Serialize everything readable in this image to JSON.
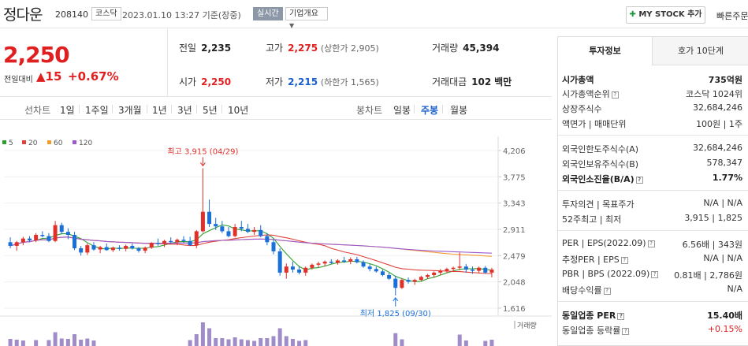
{
  "header": {
    "name": "정다운",
    "code": "208140",
    "market": "코스닥",
    "datetime": "2023.01.10 13:27  기준(장중)",
    "realtime": "실시간",
    "company_overview": "기업개요",
    "mystock_label": "MY STOCK 추가",
    "quick_order": "빠른주문"
  },
  "price": {
    "current": "2,250",
    "change_label": "전일대비",
    "change_value": "15",
    "change_pct": "+0.67%",
    "prev_close_label": "전일",
    "prev_close": "2,235",
    "high_label": "고가",
    "high": "2,275",
    "upper_limit": "(상한가 2,905)",
    "volume_label": "거래량",
    "volume": "45,394",
    "open_label": "시가",
    "open": "2,250",
    "low_label": "저가",
    "low": "2,215",
    "lower_limit": "(하한가 1,565)",
    "amount_label": "거래대금",
    "amount": "102",
    "amount_unit": "백만"
  },
  "chart_tabs": {
    "line_label": "선차트",
    "line_periods": [
      "1일",
      "1주일",
      "3개월",
      "1년",
      "3년",
      "5년",
      "10년"
    ],
    "candle_label": "봉차트",
    "candle_periods": [
      "일봉",
      "주봉",
      "월봉"
    ],
    "candle_active": "주봉"
  },
  "chart_data": {
    "type": "candlestick",
    "legend": [
      {
        "name": "5",
        "color": "#2ca02c"
      },
      {
        "name": "20",
        "color": "#e0403a"
      },
      {
        "name": "60",
        "color": "#f39c32"
      },
      {
        "name": "120",
        "color": "#9b59d0"
      }
    ],
    "y_ticks": [
      "4,206",
      "3,775",
      "3,343",
      "2,911",
      "2,479",
      "2,048",
      "1,616"
    ],
    "ylim": [
      1616,
      4206
    ],
    "annotations": {
      "high": "최고 3,915 (04/29)",
      "low": "최저 1,825 (09/30)"
    },
    "volume_label": "거래량",
    "candles": [
      [
        2700,
        2780,
        2600,
        2640
      ],
      [
        2640,
        2720,
        2560,
        2700
      ],
      [
        2700,
        2790,
        2650,
        2760
      ],
      [
        2760,
        2800,
        2700,
        2730
      ],
      [
        2730,
        2850,
        2700,
        2820
      ],
      [
        2820,
        2880,
        2780,
        2800
      ],
      [
        2800,
        2850,
        2700,
        2720
      ],
      [
        2720,
        3050,
        2700,
        2980
      ],
      [
        2980,
        3020,
        2830,
        2870
      ],
      [
        2870,
        2930,
        2750,
        2820
      ],
      [
        2820,
        2870,
        2570,
        2600
      ],
      [
        2600,
        2640,
        2480,
        2530
      ],
      [
        2530,
        2680,
        2490,
        2650
      ],
      [
        2650,
        2700,
        2560,
        2580
      ],
      [
        2580,
        2640,
        2520,
        2620
      ],
      [
        2620,
        2680,
        2560,
        2570
      ],
      [
        2570,
        2630,
        2540,
        2610
      ],
      [
        2610,
        2650,
        2560,
        2590
      ],
      [
        2590,
        2660,
        2550,
        2640
      ],
      [
        2640,
        2680,
        2580,
        2600
      ],
      [
        2600,
        2620,
        2530,
        2560
      ],
      [
        2560,
        2630,
        2520,
        2610
      ],
      [
        2610,
        2700,
        2590,
        2690
      ],
      [
        2690,
        2760,
        2640,
        2680
      ],
      [
        2680,
        2740,
        2620,
        2720
      ],
      [
        2720,
        2780,
        2680,
        2700
      ],
      [
        2700,
        2760,
        2650,
        2740
      ],
      [
        2740,
        2800,
        2690,
        2720
      ],
      [
        2720,
        2790,
        2640,
        2650
      ],
      [
        2650,
        2900,
        2600,
        2880
      ],
      [
        2880,
        3915,
        2860,
        3200
      ],
      [
        3200,
        3400,
        2950,
        3000
      ],
      [
        3000,
        3100,
        2900,
        2960
      ],
      [
        2960,
        3050,
        2850,
        2880
      ],
      [
        2880,
        2950,
        2780,
        2800
      ],
      [
        2800,
        3000,
        2780,
        2950
      ],
      [
        2950,
        3050,
        2880,
        2920
      ],
      [
        2920,
        3000,
        2850,
        2870
      ],
      [
        2870,
        2950,
        2820,
        2900
      ],
      [
        2900,
        2980,
        2780,
        2800
      ],
      [
        2800,
        2850,
        2650,
        2700
      ],
      [
        2700,
        2750,
        2500,
        2550
      ],
      [
        2550,
        2600,
        2150,
        2200
      ],
      [
        2200,
        2350,
        2100,
        2300
      ],
      [
        2300,
        2380,
        2200,
        2250
      ],
      [
        2250,
        2300,
        2170,
        2200
      ],
      [
        2200,
        2300,
        2150,
        2280
      ],
      [
        2280,
        2350,
        2250,
        2330
      ],
      [
        2330,
        2380,
        2290,
        2350
      ],
      [
        2350,
        2400,
        2300,
        2380
      ],
      [
        2380,
        2420,
        2340,
        2360
      ],
      [
        2360,
        2420,
        2330,
        2400
      ],
      [
        2400,
        2460,
        2360,
        2380
      ],
      [
        2380,
        2450,
        2340,
        2420
      ],
      [
        2420,
        2460,
        2350,
        2370
      ],
      [
        2370,
        2400,
        2280,
        2300
      ],
      [
        2300,
        2340,
        2220,
        2260
      ],
      [
        2260,
        2300,
        2200,
        2220
      ],
      [
        2220,
        2250,
        2140,
        2160
      ],
      [
        2160,
        2200,
        2080,
        2100
      ],
      [
        2100,
        2150,
        1825,
        1950
      ],
      [
        1950,
        2100,
        1930,
        2080
      ],
      [
        2080,
        2120,
        2020,
        2050
      ],
      [
        2050,
        2100,
        2000,
        2080
      ],
      [
        2080,
        2150,
        2060,
        2130
      ],
      [
        2130,
        2180,
        2100,
        2160
      ],
      [
        2160,
        2220,
        2120,
        2200
      ],
      [
        2200,
        2260,
        2160,
        2230
      ],
      [
        2230,
        2280,
        2190,
        2260
      ],
      [
        2260,
        2300,
        2210,
        2280
      ],
      [
        2280,
        2530,
        2240,
        2300
      ],
      [
        2300,
        2340,
        2200,
        2250
      ],
      [
        2250,
        2300,
        2180,
        2230
      ],
      [
        2230,
        2300,
        2200,
        2280
      ],
      [
        2280,
        2310,
        2180,
        2200
      ],
      [
        2200,
        2280,
        2120,
        2250
      ]
    ]
  },
  "side": {
    "tab_invest": "투자정보",
    "tab_hoga": "호가 10단계",
    "rows": [
      {
        "label": "시가총액",
        "value": "735억원",
        "bold": true
      },
      {
        "label": "시가총액순위",
        "value": "코스닥 1024위",
        "help": true
      },
      {
        "label": "상장주식수",
        "value": "32,684,246"
      },
      {
        "label": "액면가 | 매매단위",
        "value": "100원 | 1주"
      },
      {
        "label": "외국인한도주식수(A)",
        "value": "32,684,246"
      },
      {
        "label": "외국인보유주식수(B)",
        "value": "578,347"
      },
      {
        "label": "외국인소진율(B/A)",
        "value": "1.77%",
        "bold": true,
        "help": true
      },
      {
        "label": "투자의견 | 목표주가",
        "value": "N/A | N/A"
      },
      {
        "label": "52주최고 | 최저",
        "value": "3,915 | 1,825"
      },
      {
        "label": "PER | EPS(2022.09)",
        "value": "6.56배 | 343원",
        "help": true
      },
      {
        "label": "추정PER | EPS",
        "value": "N/A | N/A",
        "help": true
      },
      {
        "label": "PBR | BPS (2022.09)",
        "value": "0.81배 | 2,786원",
        "help": true
      },
      {
        "label": "배당수익률",
        "value": "N/A",
        "help": true
      },
      {
        "label": "동일업종 PER",
        "value": "15.40배",
        "bold": true,
        "help": true
      },
      {
        "label": "동일업종 등락률",
        "value": "+0.15%",
        "up": true,
        "help": true
      }
    ]
  }
}
